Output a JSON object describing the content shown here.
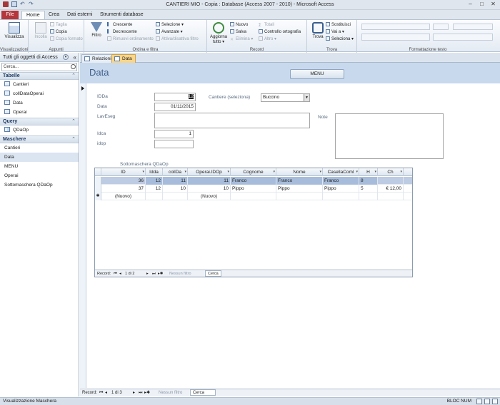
{
  "window": {
    "title": "CANTIERI MIO - Copia : Database (Access 2007 - 2010)  -  Microsoft Access",
    "controls": [
      "–",
      "□",
      "✕"
    ]
  },
  "ribbon_tabs": [
    "File",
    "Home",
    "Crea",
    "Dati esterni",
    "Strumenti database"
  ],
  "ribbon": {
    "views": {
      "visualizza": "Visualizza",
      "label": "Visualizzazioni"
    },
    "clipboard": {
      "incolla": "Incolla",
      "taglia": "Taglia",
      "copia": "Copia",
      "copia_formato": "Copia formato",
      "label": "Appunti"
    },
    "sort_filter": {
      "filtro": "Filtro",
      "crescente": "Crescente",
      "decrescente": "Decrescente",
      "rimuovi": "Rimuovi ordinamento",
      "selezione": "Selezione ▾",
      "avanzate": "Avanzate ▾",
      "attiva": "Attiva/disattiva filtro",
      "label": "Ordina e filtra"
    },
    "records": {
      "aggiorna": "Aggiorna tutto ▾",
      "nuovo": "Nuovo",
      "salva": "Salva",
      "elimina": "Elimina ▾",
      "totali": "Totali",
      "controllo": "Controllo ortografia",
      "altro": "Altro ▾",
      "label": "Record"
    },
    "find": {
      "trova": "Trova",
      "sostituisci": "Sostituisci",
      "vai_a": "Vai a ▾",
      "seleziona": "Seleziona ▾",
      "label": "Trova"
    },
    "text_format": {
      "label": "Formattazione testo"
    }
  },
  "nav_pane": {
    "header": "Tutti gli oggetti di Access",
    "search_placeholder": "Cerca...",
    "sections": [
      {
        "title": "Tabelle",
        "items": [
          "Cantieri",
          "collDataOperai",
          "Data",
          "Operai"
        ]
      },
      {
        "title": "Query",
        "items": [
          "QDaOp"
        ]
      },
      {
        "title": "Maschere",
        "items": [
          "Cantieri",
          "Data",
          "MENU",
          "Operai",
          "Sottomaschera QDaOp"
        ]
      }
    ],
    "selected_item": "Data"
  },
  "doc_tabs": [
    "Relazioni",
    "Data"
  ],
  "form": {
    "title": "Data",
    "menu_button": "MENU",
    "fields": {
      "idda_label": "IDDa",
      "idda_value": "12",
      "data_label": "Data",
      "data_value": "01/11/2015",
      "laveseg_label": "LavEseg",
      "laveseg_value": "",
      "idca_label": "Idca",
      "idca_value": "1",
      "idop_label": "idop",
      "idop_value": "",
      "cantiere_label": "Cantiere (seleziona)",
      "cantiere_value": "Buccino",
      "note_label": "Note",
      "note_value": ""
    },
    "subform": {
      "label": "Sottomaschera QDaOp",
      "columns": [
        "ID",
        "Idda",
        "collDa",
        "Operai.IDOp",
        "Cognome",
        "Nome",
        "CasellaComl",
        "H",
        "Ch"
      ],
      "rows": [
        [
          "36",
          "12",
          "11",
          "11",
          "Franco",
          "Franco",
          "Franco",
          "8",
          ""
        ],
        [
          "37",
          "12",
          "10",
          "10",
          "Pippo",
          "Pippo",
          "Pippo",
          "5",
          "€ 12,00"
        ]
      ],
      "new_row": [
        "(Nuovo)",
        "",
        "",
        "(Nuovo)",
        "",
        "",
        "",
        "",
        ""
      ],
      "navigator": {
        "record_label": "Record:",
        "position": "1 di 2",
        "filter": "Nessun filtro",
        "search": "Cerca"
      }
    }
  },
  "main_navigator": {
    "record_label": "Record:",
    "position": "1 di 3",
    "filter": "Nessun filtro",
    "search": "Cerca"
  },
  "status": {
    "left": "Visualizzazione Maschera",
    "right": "BLOC NUM"
  }
}
